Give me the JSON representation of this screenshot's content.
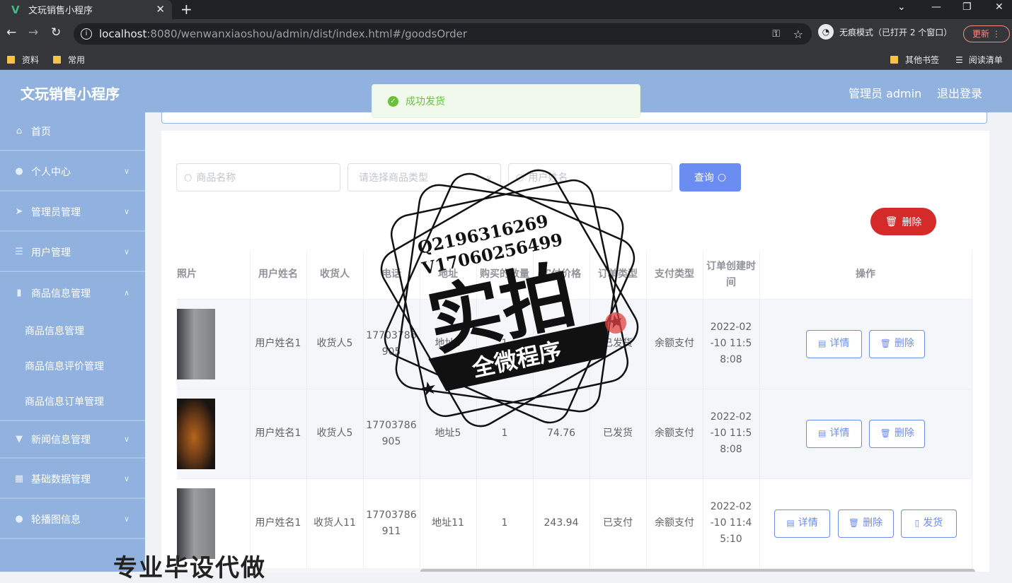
{
  "browser": {
    "tab_title": "文玩销售小程序",
    "url_host": "localhost",
    "url_path": ":8080/wenwanxiaoshou/admin/dist/index.html#/goodsOrder",
    "incognito_label": "无痕模式（已打开 2 个窗口）",
    "update_label": "更新",
    "bookmarks": [
      "资料",
      "常用"
    ],
    "bookmarks_right": [
      "其他书签",
      "阅读清单"
    ]
  },
  "header": {
    "title": "文玩销售小程序",
    "admin_label": "管理员 admin",
    "logout_label": "退出登录"
  },
  "toast": {
    "message": "成功发货"
  },
  "sidebar": {
    "items": [
      {
        "label": "首页",
        "icon": "home-icon"
      },
      {
        "label": "个人中心",
        "icon": "user-icon"
      },
      {
        "label": "管理员管理",
        "icon": "send-icon"
      },
      {
        "label": "用户管理",
        "icon": "list-icon"
      },
      {
        "label": "商品信息管理",
        "icon": "chart-icon"
      },
      {
        "label": "新闻信息管理",
        "icon": "news-icon"
      },
      {
        "label": "基础数据管理",
        "icon": "grid-icon"
      },
      {
        "label": "轮播图信息",
        "icon": "user-icon"
      }
    ],
    "sub_items": [
      "商品信息管理",
      "商品信息评价管理",
      "商品信息订单管理"
    ]
  },
  "search": {
    "goods_name_placeholder": "商品名称",
    "goods_type_placeholder": "请选择商品类型",
    "user_name_placeholder": "用户姓名",
    "query_label": "查询"
  },
  "actions": {
    "delete_label": "删除"
  },
  "table": {
    "headers": [
      "照片",
      "用户姓名",
      "收货人",
      "电话",
      "地址",
      "购买的数量",
      "实付价格",
      "订单类型",
      "支付类型",
      "订单创建时间",
      "操作"
    ],
    "rows": [
      {
        "user": "用户姓名1",
        "receiver": "收货人5",
        "phone": "17703786905",
        "address": "地址5",
        "qty": "1",
        "price": "243.94",
        "order_type": "已发货",
        "pay_type": "余额支付",
        "created": "2022-02-10 11:58:08",
        "buttons": [
          "详情",
          "删除"
        ]
      },
      {
        "user": "用户姓名1",
        "receiver": "收货人5",
        "phone": "17703786905",
        "address": "地址5",
        "qty": "1",
        "price": "74.76",
        "order_type": "已发货",
        "pay_type": "余额支付",
        "created": "2022-02-10 11:58:08",
        "buttons": [
          "详情",
          "删除"
        ]
      },
      {
        "user": "用户姓名1",
        "receiver": "收货人11",
        "phone": "17703786911",
        "address": "地址11",
        "qty": "1",
        "price": "243.94",
        "order_type": "已支付",
        "pay_type": "余额支付",
        "created": "2022-02-10 11:45:10",
        "buttons": [
          "详情",
          "删除",
          "发货"
        ]
      }
    ]
  },
  "watermark": {
    "line1": "Q2196316269",
    "line2": "V17060256499",
    "main": "实拍",
    "banner": "全微程序",
    "bottom": "专业毕设代做"
  }
}
